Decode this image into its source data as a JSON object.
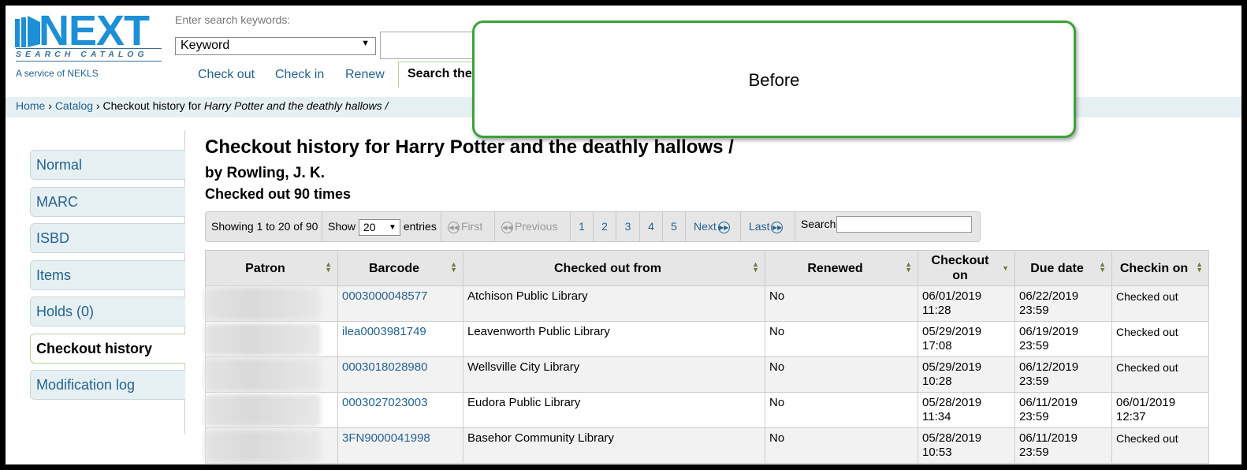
{
  "logo": {
    "word": "NEXT",
    "subtitle": "SEARCH CATALOG",
    "service": "A service of NEKLS"
  },
  "search": {
    "hint": "Enter search keywords:",
    "type_selected": "Keyword"
  },
  "subnav": {
    "items": [
      "Check out",
      "Check in",
      "Renew"
    ],
    "tab_label": "Search the"
  },
  "breadcrumb": {
    "home": "Home",
    "sep": "›",
    "catalog": "Catalog",
    "prefix": "Checkout history for",
    "title": "Harry Potter and the deathly hallows /"
  },
  "callout": {
    "text": "Before"
  },
  "sidebar": {
    "items": [
      {
        "label": "Normal"
      },
      {
        "label": "MARC"
      },
      {
        "label": "ISBD"
      },
      {
        "label": "Items"
      },
      {
        "label": "Holds (0)"
      },
      {
        "label": "Checkout history",
        "active": true
      },
      {
        "label": "Modification log"
      }
    ]
  },
  "page": {
    "title": "Checkout history for Harry Potter and the deathly hallows /",
    "author": "by Rowling, J. K.",
    "count": "Checked out 90 times"
  },
  "pager": {
    "showing": "Showing 1 to 20 of 90",
    "show_label": "Show",
    "show_value": "20",
    "entries_label": "entries",
    "first": "First",
    "previous": "Previous",
    "pages": [
      "1",
      "2",
      "3",
      "4",
      "5"
    ],
    "next": "Next",
    "last": "Last",
    "search_label": "Search:"
  },
  "table": {
    "headers": {
      "patron": "Patron",
      "barcode": "Barcode",
      "from": "Checked out from",
      "renewed": "Renewed",
      "checkout_on_1": "Checkout",
      "checkout_on_2": "on",
      "due": "Due date",
      "checkin": "Checkin on"
    },
    "rows": [
      {
        "barcode": "0003000048577",
        "from": "Atchison Public Library",
        "renewed": "No",
        "out_date": "06/01/2019",
        "out_time": "11:28",
        "due_date": "06/22/2019",
        "due_time": "23:59",
        "in_date": "Checked out",
        "in_time": ""
      },
      {
        "barcode": "ilea0003981749",
        "from": "Leavenworth Public Library",
        "renewed": "No",
        "out_date": "05/29/2019",
        "out_time": "17:08",
        "due_date": "06/19/2019",
        "due_time": "23:59",
        "in_date": "Checked out",
        "in_time": ""
      },
      {
        "barcode": "0003018028980",
        "from": "Wellsville City Library",
        "renewed": "No",
        "out_date": "05/29/2019",
        "out_time": "10:28",
        "due_date": "06/12/2019",
        "due_time": "23:59",
        "in_date": "Checked out",
        "in_time": ""
      },
      {
        "barcode": "0003027023003",
        "from": "Eudora Public Library",
        "renewed": "No",
        "out_date": "05/28/2019",
        "out_time": "11:34",
        "due_date": "06/11/2019",
        "due_time": "23:59",
        "in_date": "06/01/2019",
        "in_time": "12:37"
      },
      {
        "barcode": "3FN9000041998",
        "from": "Basehor Community Library",
        "renewed": "No",
        "out_date": "05/28/2019",
        "out_time": "10:53",
        "due_date": "06/11/2019",
        "due_time": "23:59",
        "in_date": "Checked out",
        "in_time": ""
      }
    ]
  }
}
